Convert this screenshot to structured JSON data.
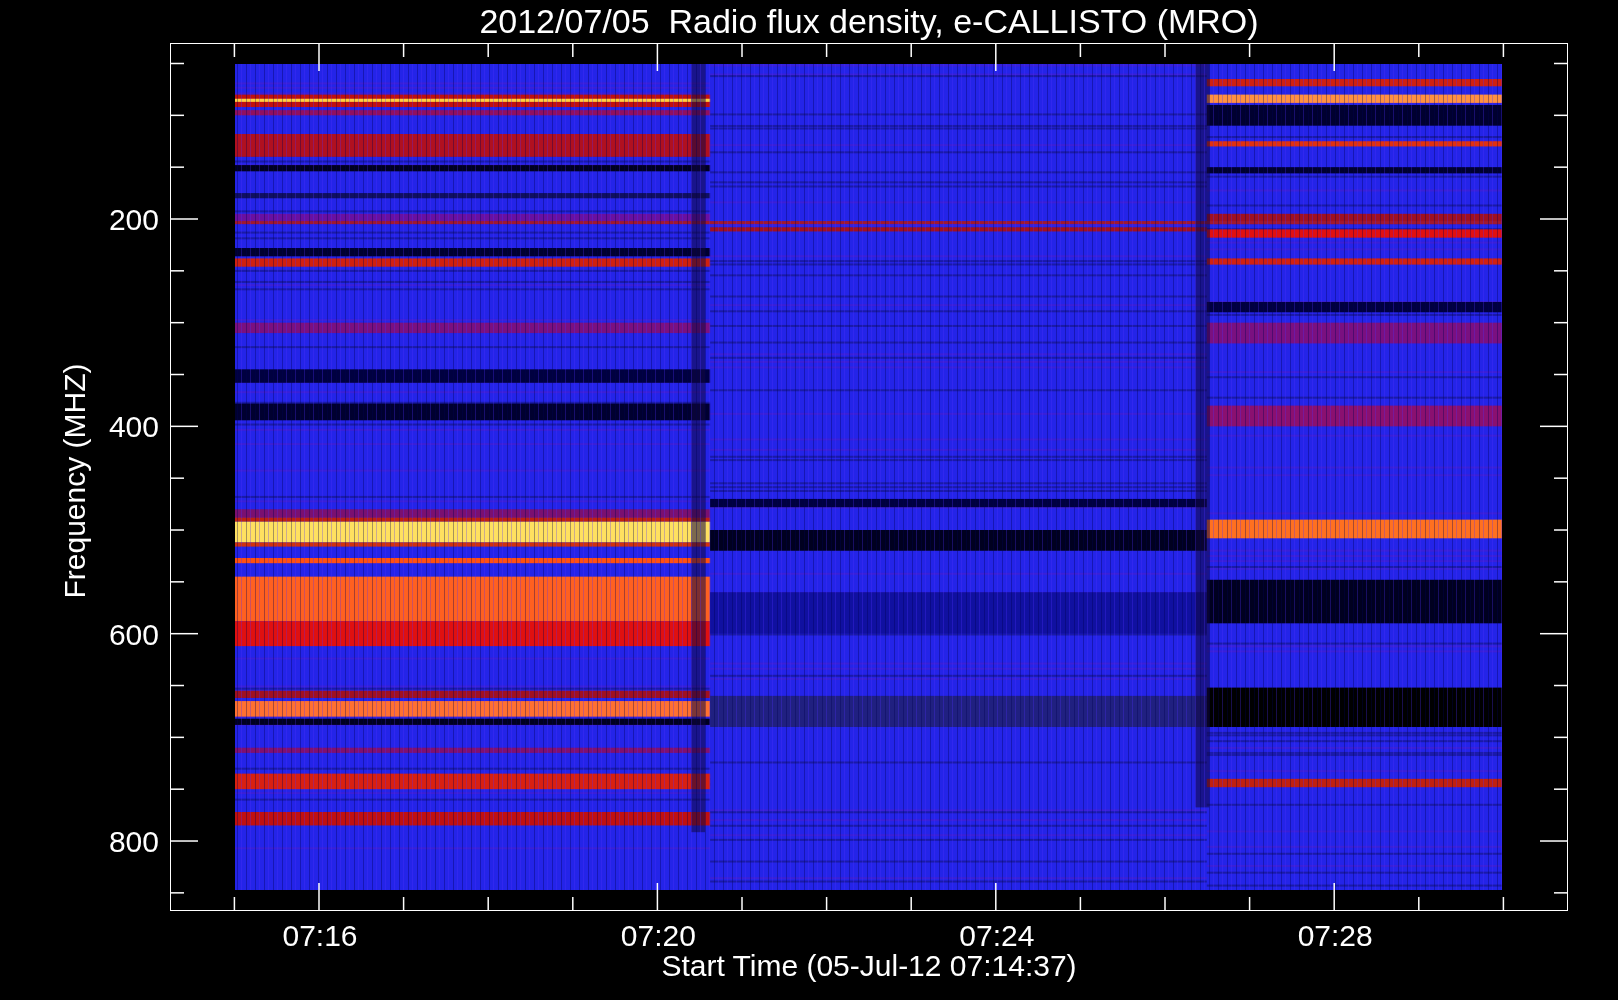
{
  "title": "2012/07/05  Radio flux density, e-CALLISTO (MRO)",
  "y_axis": {
    "label": "Frequency (MHZ)",
    "ticks": [
      "200",
      "400",
      "600",
      "800"
    ]
  },
  "x_axis": {
    "label": "Start Time (05-Jul-12 07:14:37)",
    "ticks": [
      "07:16",
      "07:20",
      "07:24",
      "07:28"
    ]
  }
}
